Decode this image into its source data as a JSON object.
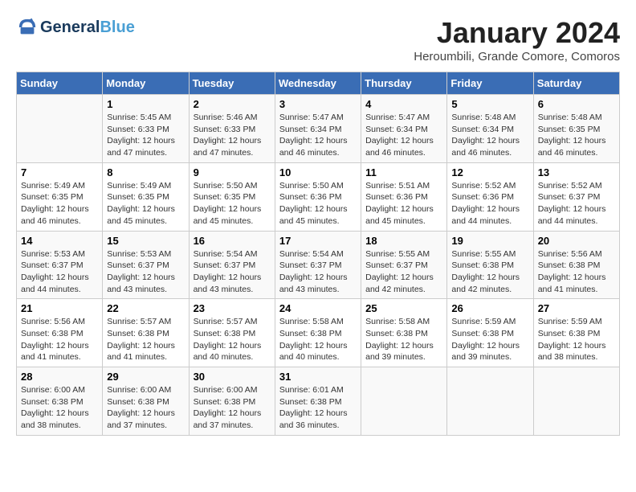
{
  "header": {
    "logo_line1": "General",
    "logo_line2": "Blue",
    "month": "January 2024",
    "location": "Heroumbili, Grande Comore, Comoros"
  },
  "weekdays": [
    "Sunday",
    "Monday",
    "Tuesday",
    "Wednesday",
    "Thursday",
    "Friday",
    "Saturday"
  ],
  "weeks": [
    [
      {
        "day": "",
        "info": ""
      },
      {
        "day": "1",
        "info": "Sunrise: 5:45 AM\nSunset: 6:33 PM\nDaylight: 12 hours\nand 47 minutes."
      },
      {
        "day": "2",
        "info": "Sunrise: 5:46 AM\nSunset: 6:33 PM\nDaylight: 12 hours\nand 47 minutes."
      },
      {
        "day": "3",
        "info": "Sunrise: 5:47 AM\nSunset: 6:34 PM\nDaylight: 12 hours\nand 46 minutes."
      },
      {
        "day": "4",
        "info": "Sunrise: 5:47 AM\nSunset: 6:34 PM\nDaylight: 12 hours\nand 46 minutes."
      },
      {
        "day": "5",
        "info": "Sunrise: 5:48 AM\nSunset: 6:34 PM\nDaylight: 12 hours\nand 46 minutes."
      },
      {
        "day": "6",
        "info": "Sunrise: 5:48 AM\nSunset: 6:35 PM\nDaylight: 12 hours\nand 46 minutes."
      }
    ],
    [
      {
        "day": "7",
        "info": "Sunrise: 5:49 AM\nSunset: 6:35 PM\nDaylight: 12 hours\nand 46 minutes."
      },
      {
        "day": "8",
        "info": "Sunrise: 5:49 AM\nSunset: 6:35 PM\nDaylight: 12 hours\nand 45 minutes."
      },
      {
        "day": "9",
        "info": "Sunrise: 5:50 AM\nSunset: 6:35 PM\nDaylight: 12 hours\nand 45 minutes."
      },
      {
        "day": "10",
        "info": "Sunrise: 5:50 AM\nSunset: 6:36 PM\nDaylight: 12 hours\nand 45 minutes."
      },
      {
        "day": "11",
        "info": "Sunrise: 5:51 AM\nSunset: 6:36 PM\nDaylight: 12 hours\nand 45 minutes."
      },
      {
        "day": "12",
        "info": "Sunrise: 5:52 AM\nSunset: 6:36 PM\nDaylight: 12 hours\nand 44 minutes."
      },
      {
        "day": "13",
        "info": "Sunrise: 5:52 AM\nSunset: 6:37 PM\nDaylight: 12 hours\nand 44 minutes."
      }
    ],
    [
      {
        "day": "14",
        "info": "Sunrise: 5:53 AM\nSunset: 6:37 PM\nDaylight: 12 hours\nand 44 minutes."
      },
      {
        "day": "15",
        "info": "Sunrise: 5:53 AM\nSunset: 6:37 PM\nDaylight: 12 hours\nand 43 minutes."
      },
      {
        "day": "16",
        "info": "Sunrise: 5:54 AM\nSunset: 6:37 PM\nDaylight: 12 hours\nand 43 minutes."
      },
      {
        "day": "17",
        "info": "Sunrise: 5:54 AM\nSunset: 6:37 PM\nDaylight: 12 hours\nand 43 minutes."
      },
      {
        "day": "18",
        "info": "Sunrise: 5:55 AM\nSunset: 6:37 PM\nDaylight: 12 hours\nand 42 minutes."
      },
      {
        "day": "19",
        "info": "Sunrise: 5:55 AM\nSunset: 6:38 PM\nDaylight: 12 hours\nand 42 minutes."
      },
      {
        "day": "20",
        "info": "Sunrise: 5:56 AM\nSunset: 6:38 PM\nDaylight: 12 hours\nand 41 minutes."
      }
    ],
    [
      {
        "day": "21",
        "info": "Sunrise: 5:56 AM\nSunset: 6:38 PM\nDaylight: 12 hours\nand 41 minutes."
      },
      {
        "day": "22",
        "info": "Sunrise: 5:57 AM\nSunset: 6:38 PM\nDaylight: 12 hours\nand 41 minutes."
      },
      {
        "day": "23",
        "info": "Sunrise: 5:57 AM\nSunset: 6:38 PM\nDaylight: 12 hours\nand 40 minutes."
      },
      {
        "day": "24",
        "info": "Sunrise: 5:58 AM\nSunset: 6:38 PM\nDaylight: 12 hours\nand 40 minutes."
      },
      {
        "day": "25",
        "info": "Sunrise: 5:58 AM\nSunset: 6:38 PM\nDaylight: 12 hours\nand 39 minutes."
      },
      {
        "day": "26",
        "info": "Sunrise: 5:59 AM\nSunset: 6:38 PM\nDaylight: 12 hours\nand 39 minutes."
      },
      {
        "day": "27",
        "info": "Sunrise: 5:59 AM\nSunset: 6:38 PM\nDaylight: 12 hours\nand 38 minutes."
      }
    ],
    [
      {
        "day": "28",
        "info": "Sunrise: 6:00 AM\nSunset: 6:38 PM\nDaylight: 12 hours\nand 38 minutes."
      },
      {
        "day": "29",
        "info": "Sunrise: 6:00 AM\nSunset: 6:38 PM\nDaylight: 12 hours\nand 37 minutes."
      },
      {
        "day": "30",
        "info": "Sunrise: 6:00 AM\nSunset: 6:38 PM\nDaylight: 12 hours\nand 37 minutes."
      },
      {
        "day": "31",
        "info": "Sunrise: 6:01 AM\nSunset: 6:38 PM\nDaylight: 12 hours\nand 36 minutes."
      },
      {
        "day": "",
        "info": ""
      },
      {
        "day": "",
        "info": ""
      },
      {
        "day": "",
        "info": ""
      }
    ]
  ]
}
